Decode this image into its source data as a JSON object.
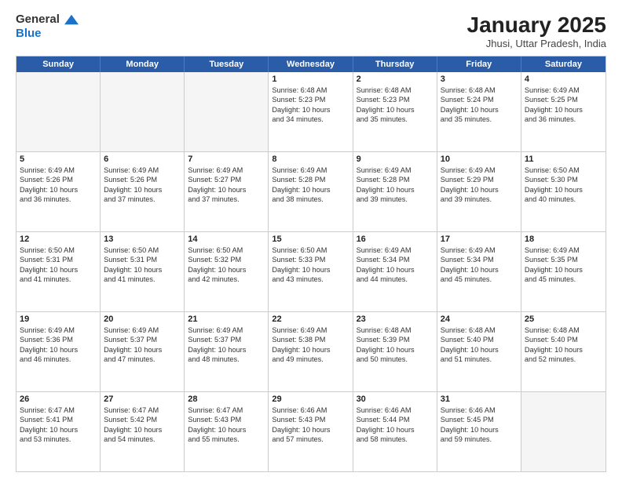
{
  "header": {
    "logo_general": "General",
    "logo_blue": "Blue",
    "title": "January 2025",
    "subtitle": "Jhusi, Uttar Pradesh, India"
  },
  "weekdays": [
    "Sunday",
    "Monday",
    "Tuesday",
    "Wednesday",
    "Thursday",
    "Friday",
    "Saturday"
  ],
  "rows": [
    [
      {
        "day": "",
        "text": "",
        "empty": true
      },
      {
        "day": "",
        "text": "",
        "empty": true
      },
      {
        "day": "",
        "text": "",
        "empty": true
      },
      {
        "day": "1",
        "text": "Sunrise: 6:48 AM\nSunset: 5:23 PM\nDaylight: 10 hours\nand 34 minutes."
      },
      {
        "day": "2",
        "text": "Sunrise: 6:48 AM\nSunset: 5:23 PM\nDaylight: 10 hours\nand 35 minutes."
      },
      {
        "day": "3",
        "text": "Sunrise: 6:48 AM\nSunset: 5:24 PM\nDaylight: 10 hours\nand 35 minutes."
      },
      {
        "day": "4",
        "text": "Sunrise: 6:49 AM\nSunset: 5:25 PM\nDaylight: 10 hours\nand 36 minutes."
      }
    ],
    [
      {
        "day": "5",
        "text": "Sunrise: 6:49 AM\nSunset: 5:26 PM\nDaylight: 10 hours\nand 36 minutes."
      },
      {
        "day": "6",
        "text": "Sunrise: 6:49 AM\nSunset: 5:26 PM\nDaylight: 10 hours\nand 37 minutes."
      },
      {
        "day": "7",
        "text": "Sunrise: 6:49 AM\nSunset: 5:27 PM\nDaylight: 10 hours\nand 37 minutes."
      },
      {
        "day": "8",
        "text": "Sunrise: 6:49 AM\nSunset: 5:28 PM\nDaylight: 10 hours\nand 38 minutes."
      },
      {
        "day": "9",
        "text": "Sunrise: 6:49 AM\nSunset: 5:28 PM\nDaylight: 10 hours\nand 39 minutes."
      },
      {
        "day": "10",
        "text": "Sunrise: 6:49 AM\nSunset: 5:29 PM\nDaylight: 10 hours\nand 39 minutes."
      },
      {
        "day": "11",
        "text": "Sunrise: 6:50 AM\nSunset: 5:30 PM\nDaylight: 10 hours\nand 40 minutes."
      }
    ],
    [
      {
        "day": "12",
        "text": "Sunrise: 6:50 AM\nSunset: 5:31 PM\nDaylight: 10 hours\nand 41 minutes."
      },
      {
        "day": "13",
        "text": "Sunrise: 6:50 AM\nSunset: 5:31 PM\nDaylight: 10 hours\nand 41 minutes."
      },
      {
        "day": "14",
        "text": "Sunrise: 6:50 AM\nSunset: 5:32 PM\nDaylight: 10 hours\nand 42 minutes."
      },
      {
        "day": "15",
        "text": "Sunrise: 6:50 AM\nSunset: 5:33 PM\nDaylight: 10 hours\nand 43 minutes."
      },
      {
        "day": "16",
        "text": "Sunrise: 6:49 AM\nSunset: 5:34 PM\nDaylight: 10 hours\nand 44 minutes."
      },
      {
        "day": "17",
        "text": "Sunrise: 6:49 AM\nSunset: 5:34 PM\nDaylight: 10 hours\nand 45 minutes."
      },
      {
        "day": "18",
        "text": "Sunrise: 6:49 AM\nSunset: 5:35 PM\nDaylight: 10 hours\nand 45 minutes."
      }
    ],
    [
      {
        "day": "19",
        "text": "Sunrise: 6:49 AM\nSunset: 5:36 PM\nDaylight: 10 hours\nand 46 minutes."
      },
      {
        "day": "20",
        "text": "Sunrise: 6:49 AM\nSunset: 5:37 PM\nDaylight: 10 hours\nand 47 minutes."
      },
      {
        "day": "21",
        "text": "Sunrise: 6:49 AM\nSunset: 5:37 PM\nDaylight: 10 hours\nand 48 minutes."
      },
      {
        "day": "22",
        "text": "Sunrise: 6:49 AM\nSunset: 5:38 PM\nDaylight: 10 hours\nand 49 minutes."
      },
      {
        "day": "23",
        "text": "Sunrise: 6:48 AM\nSunset: 5:39 PM\nDaylight: 10 hours\nand 50 minutes."
      },
      {
        "day": "24",
        "text": "Sunrise: 6:48 AM\nSunset: 5:40 PM\nDaylight: 10 hours\nand 51 minutes."
      },
      {
        "day": "25",
        "text": "Sunrise: 6:48 AM\nSunset: 5:40 PM\nDaylight: 10 hours\nand 52 minutes."
      }
    ],
    [
      {
        "day": "26",
        "text": "Sunrise: 6:47 AM\nSunset: 5:41 PM\nDaylight: 10 hours\nand 53 minutes."
      },
      {
        "day": "27",
        "text": "Sunrise: 6:47 AM\nSunset: 5:42 PM\nDaylight: 10 hours\nand 54 minutes."
      },
      {
        "day": "28",
        "text": "Sunrise: 6:47 AM\nSunset: 5:43 PM\nDaylight: 10 hours\nand 55 minutes."
      },
      {
        "day": "29",
        "text": "Sunrise: 6:46 AM\nSunset: 5:43 PM\nDaylight: 10 hours\nand 57 minutes."
      },
      {
        "day": "30",
        "text": "Sunrise: 6:46 AM\nSunset: 5:44 PM\nDaylight: 10 hours\nand 58 minutes."
      },
      {
        "day": "31",
        "text": "Sunrise: 6:46 AM\nSunset: 5:45 PM\nDaylight: 10 hours\nand 59 minutes."
      },
      {
        "day": "",
        "text": "",
        "empty": true
      }
    ]
  ]
}
